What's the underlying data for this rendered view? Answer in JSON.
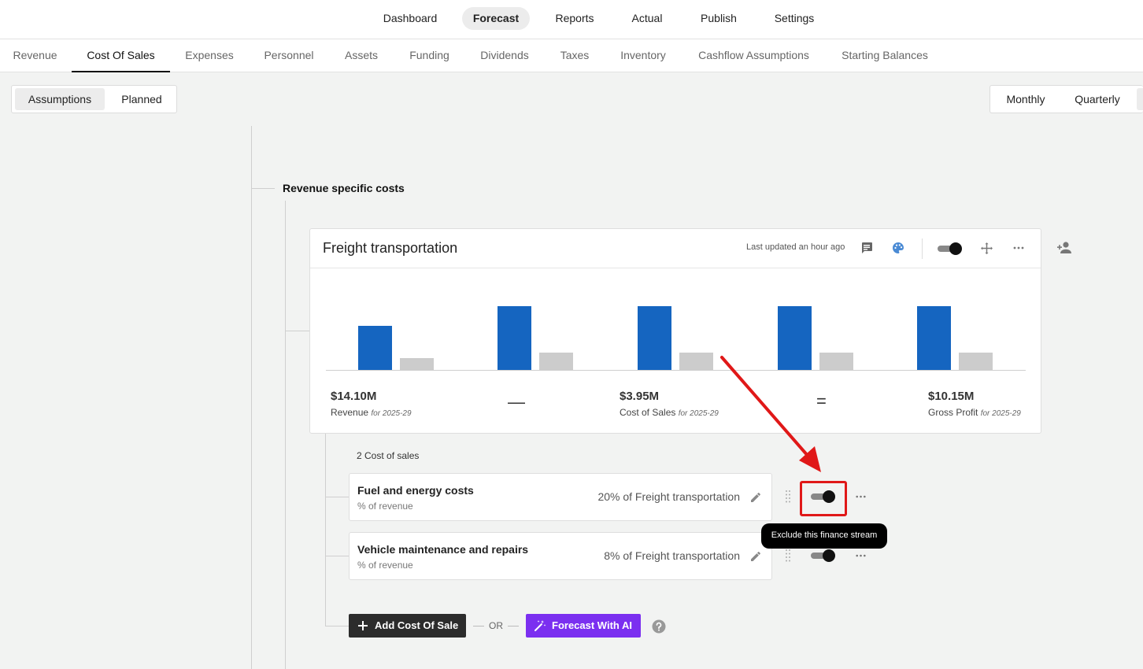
{
  "topnav": {
    "items": [
      {
        "label": "Dashboard"
      },
      {
        "label": "Forecast"
      },
      {
        "label": "Reports"
      },
      {
        "label": "Actual"
      },
      {
        "label": "Publish"
      },
      {
        "label": "Settings"
      }
    ],
    "active": "Forecast"
  },
  "subnav": {
    "tabs": [
      {
        "label": "Revenue"
      },
      {
        "label": "Cost Of Sales"
      },
      {
        "label": "Expenses"
      },
      {
        "label": "Personnel"
      },
      {
        "label": "Assets"
      },
      {
        "label": "Funding"
      },
      {
        "label": "Dividends"
      },
      {
        "label": "Taxes"
      },
      {
        "label": "Inventory"
      },
      {
        "label": "Cashflow Assumptions"
      },
      {
        "label": "Starting Balances"
      }
    ],
    "active": "Cost Of Sales"
  },
  "mode": {
    "assumptions": "Assumptions",
    "planned": "Planned",
    "active": "Assumptions"
  },
  "period": {
    "monthly": "Monthly",
    "quarterly": "Quarterly"
  },
  "section_title": "Revenue specific costs",
  "card": {
    "title": "Freight transportation",
    "last_updated": "Last updated an hour ago",
    "icons": [
      "comment-icon",
      "palette-icon",
      "toggle-switch",
      "move-icon",
      "more-icon"
    ],
    "add_user_icon": "person-add-icon",
    "chart_data": {
      "type": "bar",
      "series": [
        {
          "values": [
            0.56,
            0.81,
            0.81,
            0.81,
            0.81
          ],
          "color": "#1565c0"
        },
        {
          "values": [
            0.15,
            0.22,
            0.22,
            0.22,
            0.22
          ],
          "color": "#cccccc"
        }
      ],
      "categories": [
        "",
        "",
        "",
        "",
        ""
      ],
      "grid": false
    },
    "kpis": [
      {
        "value": "$14.10M",
        "label": "Revenue",
        "period": "for 2025-29"
      },
      {
        "value": "$3.95M",
        "label": "Cost of Sales",
        "period": "for 2025-29"
      },
      {
        "value": "$10.15M",
        "label": "Gross Profit",
        "period": "for 2025-29"
      }
    ],
    "operators": {
      "minus": "—",
      "equals": "="
    }
  },
  "cost_count": "2 Cost of sales",
  "rows": [
    {
      "name": "Fuel and energy costs",
      "sub": "% of revenue",
      "value": "20% of Freight transportation",
      "enabled": true
    },
    {
      "name": "Vehicle maintenance and repairs",
      "sub": "% of revenue",
      "value": "8% of Freight transportation",
      "enabled": true
    }
  ],
  "tooltip": "Exclude this finance stream",
  "actions": {
    "add_label": "Add Cost Of Sale",
    "or_label": "OR",
    "ai_label": "Forecast With AI"
  },
  "colors": {
    "accent_blue": "#1565c0",
    "ai_purple": "#7b2ff0",
    "annotation_red": "#e01818"
  }
}
